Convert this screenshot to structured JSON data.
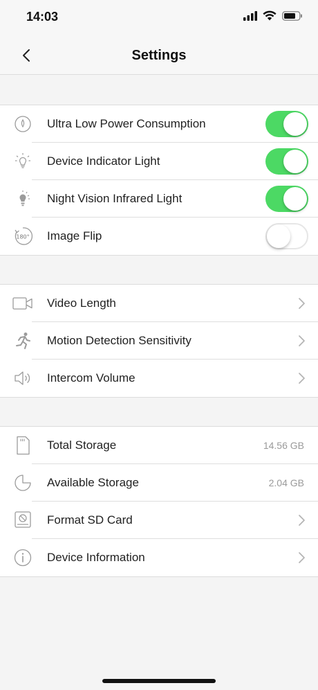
{
  "status_bar": {
    "time": "14:03"
  },
  "nav": {
    "title": "Settings"
  },
  "toggles": [
    {
      "label": "Ultra Low Power Consumption",
      "on": true,
      "icon": "power-saving-icon"
    },
    {
      "label": "Device Indicator Light",
      "on": true,
      "icon": "bulb-icon"
    },
    {
      "label": "Night Vision Infrared Light",
      "on": true,
      "icon": "infrared-light-icon"
    },
    {
      "label": "Image Flip",
      "on": false,
      "icon": "rotate-180-icon",
      "icon_text": "180°"
    }
  ],
  "media": [
    {
      "label": "Video Length",
      "icon": "video-camera-icon"
    },
    {
      "label": "Motion Detection Sensitivity",
      "icon": "running-person-icon"
    },
    {
      "label": "Intercom Volume",
      "icon": "speaker-icon"
    }
  ],
  "storage": [
    {
      "label": "Total Storage",
      "value": "14.56 GB",
      "icon": "sd-card-icon"
    },
    {
      "label": "Available Storage",
      "value": "2.04 GB",
      "icon": "pie-chart-icon"
    },
    {
      "label": "Format SD Card",
      "icon": "format-sd-icon"
    },
    {
      "label": "Device Information",
      "icon": "info-icon"
    }
  ],
  "colors": {
    "toggle_on": "#4cd964",
    "background": "#f4f4f4",
    "icon_gray": "#9b9b9b"
  }
}
